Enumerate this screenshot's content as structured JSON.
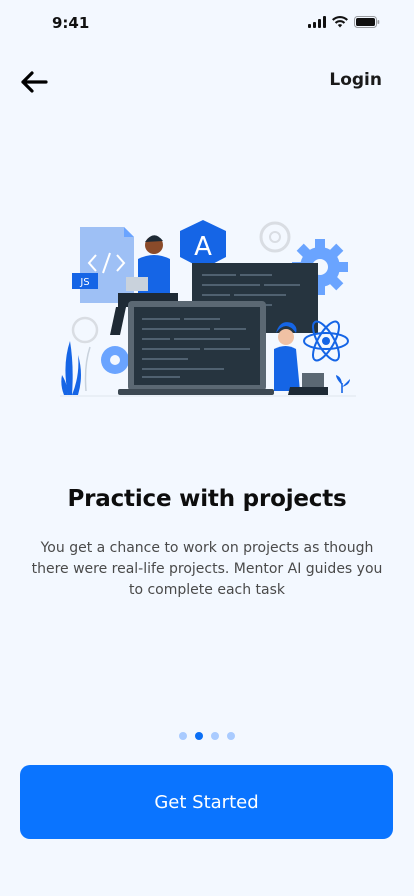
{
  "status_bar": {
    "time": "9:41",
    "icons": [
      "signal-icon",
      "wifi-icon",
      "battery-icon"
    ]
  },
  "header": {
    "back_icon": "arrow-left-icon",
    "login_label": "Login"
  },
  "illustration": {
    "badge_text": "JS",
    "logo_letter": "A"
  },
  "onboarding": {
    "title": "Practice with projects",
    "description": "You get a chance to work on projects as though there were real-life projects. Mentor AI guides you to complete each task",
    "pages": 4,
    "active_page": 2
  },
  "cta": {
    "label": "Get Started"
  },
  "colors": {
    "background": "#f3f8ff",
    "primary": "#0a74ff",
    "dot_inactive": "#a9cbff"
  }
}
